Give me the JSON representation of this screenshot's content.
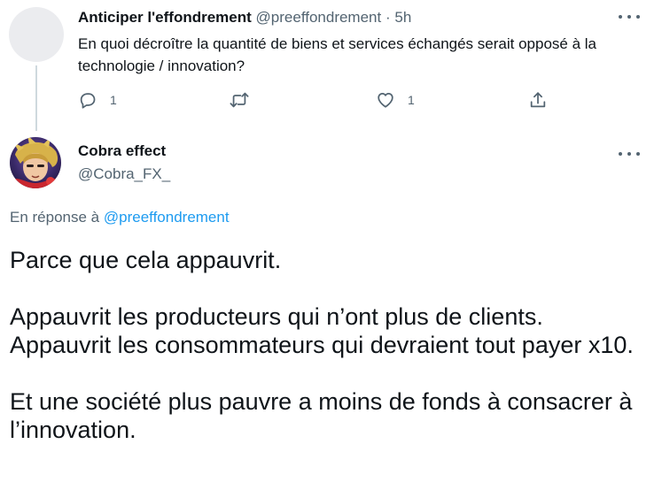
{
  "parent": {
    "display_name": "Anticiper l'effondrement",
    "handle": "@preeffondrement",
    "separator": "·",
    "time": "5h",
    "text": "En quoi décroître la quantité de biens et services échangés serait opposé à la technologie / innovation?",
    "actions": {
      "reply_count": "1",
      "retweet_count": "",
      "like_count": "1"
    }
  },
  "reply": {
    "display_name": "Cobra effect",
    "handle": "@Cobra_FX_",
    "reply_prefix": "En réponse à",
    "reply_mention": "@preeffondrement",
    "paragraphs": [
      [
        "Parce que cela appauvrit."
      ],
      [
        "Appauvrit les producteurs qui n’ont plus de clients.",
        "Appauvrit les consommateurs qui devraient tout payer x10."
      ],
      [
        "Et une société plus pauvre a moins de fonds à consacrer à l’innovation."
      ]
    ]
  },
  "icons": {
    "reply": "reply-icon",
    "retweet": "retweet-icon",
    "like": "heart-icon",
    "share": "share-icon",
    "more": "more-options-icon"
  },
  "colors": {
    "text": "#0f1419",
    "secondary": "#536471",
    "link": "#1d9bf0",
    "thread_line": "#cfd9de"
  }
}
